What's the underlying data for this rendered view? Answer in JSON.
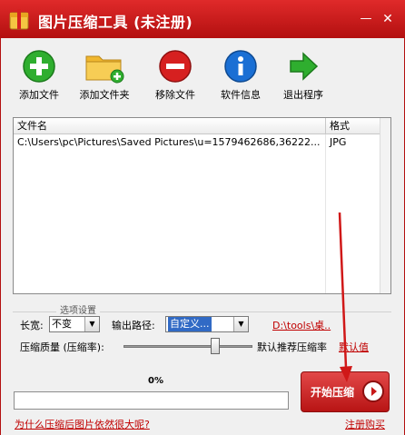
{
  "window": {
    "title": "图片压缩工具 (未注册)",
    "minimize": "—",
    "close": "✕"
  },
  "toolbar": [
    {
      "label": "添加文件",
      "icon": "add-file-icon",
      "color": "#2fae2f"
    },
    {
      "label": "添加文件夹",
      "icon": "add-folder-icon",
      "color": "#f0b72f"
    },
    {
      "label": "移除文件",
      "icon": "remove-file-icon",
      "color": "#d62020"
    },
    {
      "label": "软件信息",
      "icon": "info-icon",
      "color": "#1a6fd4"
    },
    {
      "label": "退出程序",
      "icon": "exit-icon",
      "color": "#2fae2f"
    }
  ],
  "filelist": {
    "columns": [
      "文件名",
      "格式"
    ],
    "rows": [
      {
        "name": "C:\\Users\\pc\\Pictures\\Saved Pictures\\u=1579462686,36222...",
        "format": "JPG"
      }
    ]
  },
  "options": {
    "group_title": "选项设置",
    "size_label": "长宽:",
    "size_value": "不变",
    "path_label": "输出路径:",
    "path_value": "自定义...",
    "path_link": "D:\\tools\\桌..",
    "quality_label": "压缩质量 (压缩率):",
    "quality_level": 0.73,
    "recommend_text": "默认推荐压缩率",
    "default_link": "默认值"
  },
  "progress": {
    "percent_text": "0%",
    "fraction": 0
  },
  "start_button": {
    "label": "开始压缩"
  },
  "footer": {
    "why_link": "为什么压缩后图片依然很大呢?",
    "register_link": "注册购买"
  },
  "colors": {
    "title_bar": "#c81818",
    "accent": "#c00000"
  }
}
